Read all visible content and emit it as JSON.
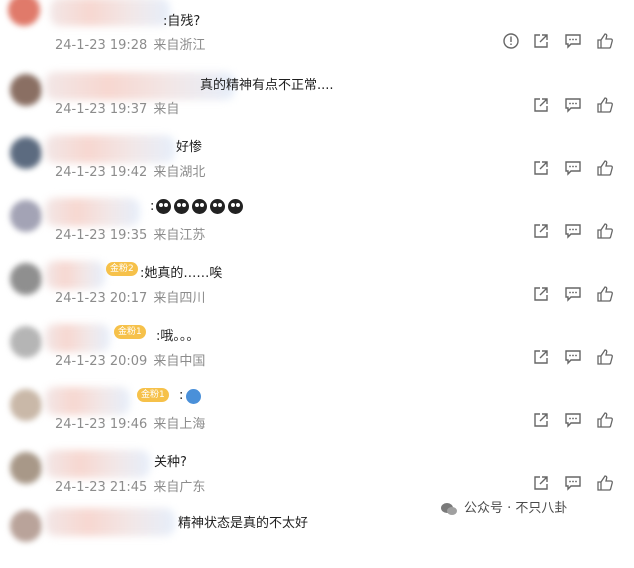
{
  "comments": [
    {
      "text": ":自残?",
      "date": "24-1-23 19:28",
      "location": "来自浙江",
      "has_report": true
    },
    {
      "text": "真的精神有点不正常....",
      "date": "24-1-23 19:37",
      "location": "来自",
      "has_report": false
    },
    {
      "text": "好惨",
      "date": "24-1-23 19:42",
      "location": "来自湖北",
      "has_report": false
    },
    {
      "text": ":",
      "date": "24-1-23 19:35",
      "location": "来自江苏",
      "has_report": false,
      "emoji_count": 5
    },
    {
      "text": ":她真的……唉",
      "date": "24-1-23 20:17",
      "location": "来自四川",
      "badge": "金粉2",
      "has_report": false
    },
    {
      "text": ":哦。。。",
      "date": "24-1-23 20:09",
      "location": "来自中国",
      "badge": "金粉1",
      "has_report": false
    },
    {
      "text": ":",
      "date": "24-1-23 19:46",
      "location": "来自上海",
      "badge": "金粉1",
      "has_report": false
    },
    {
      "text": "关种?",
      "date": "24-1-23 21:45",
      "location": "来自广东",
      "has_report": false
    },
    {
      "text": "精神状态是真的不太好",
      "date": "",
      "location": "",
      "has_report": false
    }
  ],
  "watermark": {
    "text": "公众号 · 不只八卦"
  },
  "icons": {
    "report": "report-icon",
    "share": "share-icon",
    "reply": "comment-icon",
    "like": "like-icon"
  }
}
